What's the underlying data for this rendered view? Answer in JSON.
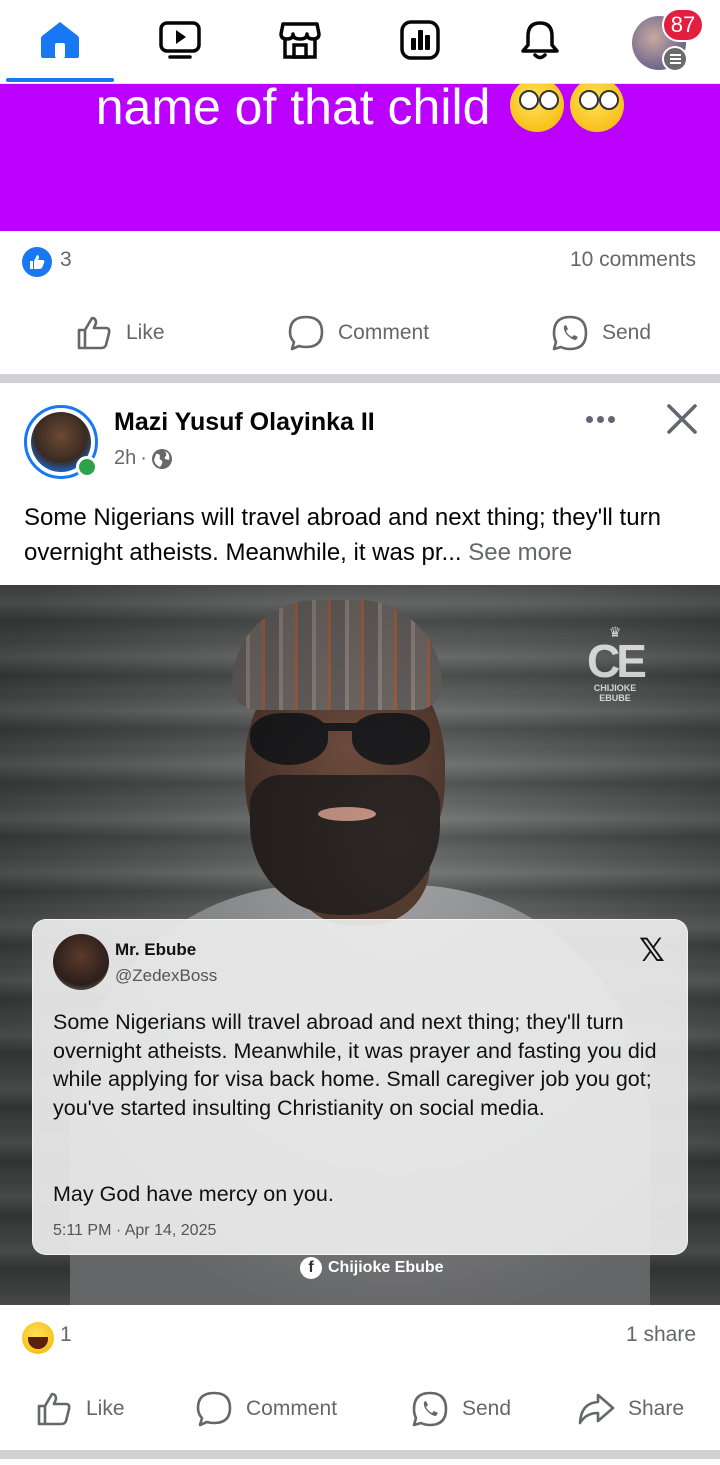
{
  "nav": {
    "items": [
      {
        "icon": "home-icon",
        "active": true
      },
      {
        "icon": "video-icon"
      },
      {
        "icon": "marketplace-icon"
      },
      {
        "icon": "dashboard-icon"
      },
      {
        "icon": "bell-icon"
      }
    ],
    "notification_badge": "87",
    "accent_color": "#1877f2"
  },
  "prev_post": {
    "text_fragment": "name of that child",
    "background_color": "#bb00ff",
    "reaction_count": "3",
    "comments": "10 comments",
    "actions": {
      "like": "Like",
      "comment": "Comment",
      "send": "Send"
    }
  },
  "post": {
    "author": "Mazi Yusuf Olayinka II",
    "time": "2h",
    "time_separator": "·",
    "text": "Some Nigerians will travel abroad and next thing; they'll turn overnight atheists. Meanwhile, it was pr...",
    "see_more": "See more",
    "photo": {
      "watermark_logo": "CE",
      "watermark_text": "CHIJIOKE EBUBE",
      "tweet": {
        "name": "Mr. Ebube",
        "handle": "@ZedexBoss",
        "platform_icon": "𝕏",
        "body": "Some Nigerians will travel abroad and next thing; they'll turn overnight atheists. Meanwhile, it was prayer and fasting you did while applying for visa back home. Small caregiver job you got; you've started insulting Christianity on social media.",
        "body2": "May God have mercy on you.",
        "timestamp": "5:11 PM · Apr 14, 2025"
      },
      "credit_icon": "f",
      "credit": "Chijioke Ebube"
    },
    "reaction_count": "1",
    "shares": "1 share",
    "actions": {
      "like": "Like",
      "comment": "Comment",
      "send": "Send",
      "share": "Share"
    }
  }
}
